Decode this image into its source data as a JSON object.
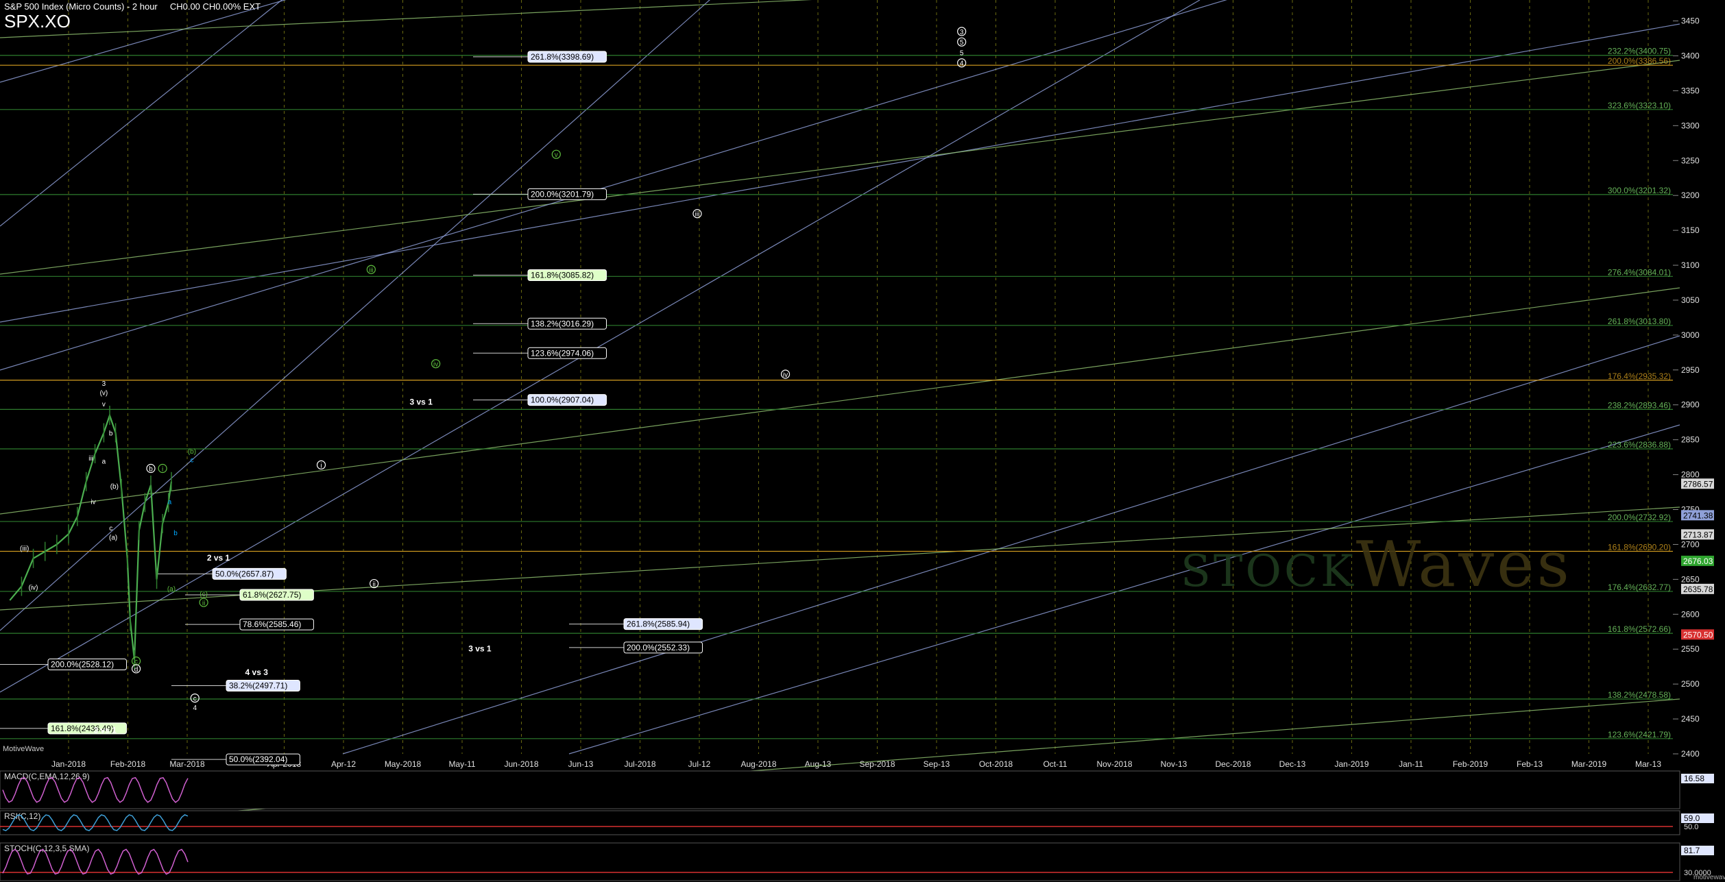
{
  "header": {
    "title": "S&P 500 Index (Micro Counts) - 2 hour",
    "quote": "CH0.00  CH0.00%  EXT",
    "symbol": "SPX.XO"
  },
  "brand": "MotiveWave",
  "watermark": {
    "prefix": "STOCK",
    "suffix": "Waves"
  },
  "footer_brand": "motivewave",
  "colors": {
    "background": "#000000",
    "price_bars": "#2e7d2e",
    "fib_label": "#ffffff",
    "fib_green": "#3aa53a",
    "fib_orange": "#d8a020",
    "channel_blue": "#8f9fd8",
    "channel_green": "#8fbf6f",
    "grid": "#5f5f10"
  },
  "chart_data": {
    "type": "line",
    "title": "S&P 500 Index (Micro Counts) - 2 hour",
    "ylim": [
      2400,
      3480
    ],
    "y_ticks": [
      2400,
      2450,
      2500,
      2550,
      2600,
      2650,
      2700,
      2750,
      2800,
      2850,
      2900,
      2950,
      3000,
      3050,
      3100,
      3150,
      3200,
      3250,
      3300,
      3350,
      3400,
      3450
    ],
    "x_ticks": [
      "Jan-2018",
      "Feb-2018",
      "Mar-2018",
      "Apr-2018",
      "Apr-12",
      "May-2018",
      "May-11",
      "Jun-2018",
      "Jun-13",
      "Jul-2018",
      "Jul-12",
      "Aug-2018",
      "Aug-13",
      "Sep-2018",
      "Sep-13",
      "Oct-2018",
      "Oct-11",
      "Nov-2018",
      "Nov-13",
      "Dec-2018",
      "Dec-13",
      "Jan-2019",
      "Jan-11",
      "Feb-2019",
      "Feb-13",
      "Mar-2019",
      "Mar-13"
    ],
    "series": [
      {
        "values": [
          [
            -1.0,
            2620
          ],
          [
            -0.8,
            2640
          ],
          [
            -0.6,
            2680
          ],
          [
            -0.4,
            2690
          ],
          [
            -0.2,
            2700
          ],
          [
            0.0,
            2715
          ],
          [
            0.15,
            2740
          ],
          [
            0.3,
            2790
          ],
          [
            0.45,
            2830
          ],
          [
            0.6,
            2860
          ],
          [
            0.7,
            2885
          ],
          [
            0.8,
            2860
          ],
          [
            0.9,
            2780
          ],
          [
            1.0,
            2680
          ],
          [
            1.05,
            2590
          ],
          [
            1.12,
            2535
          ],
          [
            1.2,
            2720
          ],
          [
            1.3,
            2760
          ],
          [
            1.4,
            2785
          ],
          [
            1.5,
            2650
          ],
          [
            1.6,
            2730
          ],
          [
            1.7,
            2760
          ],
          [
            1.75,
            2790
          ]
        ]
      }
    ],
    "fib_levels": [
      {
        "label": "261.8%(3398.69)",
        "value": 3398.69,
        "color": "blue"
      },
      {
        "label": "200.0%(3201.79)",
        "value": 3201.79,
        "color": "white"
      },
      {
        "label": "161.8%(3085.82)",
        "value": 3085.82,
        "color": "green"
      },
      {
        "label": "138.2%(3016.29)",
        "value": 3016.29,
        "color": "white"
      },
      {
        "label": "123.6%(2974.06)",
        "value": 2974.06,
        "color": "white"
      },
      {
        "label": "100.0%(2907.04)",
        "value": 2907.04,
        "color": "blue"
      },
      {
        "label": "50.0%(2657.87)",
        "value": 2657.87,
        "color": "blue"
      },
      {
        "label": "61.8%(2627.75)",
        "value": 2627.75,
        "color": "green"
      },
      {
        "label": "78.6%(2585.46)",
        "value": 2585.46,
        "color": "white"
      },
      {
        "label": "261.8%(2585.94)",
        "value": 2585.94,
        "color": "blue"
      },
      {
        "label": "200.0%(2552.33)",
        "value": 2552.33,
        "color": "white"
      },
      {
        "label": "200.0%(2528.12)",
        "value": 2528.12,
        "color": "white"
      },
      {
        "label": "38.2%(2497.71)",
        "value": 2497.71,
        "color": "blue"
      },
      {
        "label": "161.8%(2436.49)",
        "value": 2436.49,
        "color": "green"
      },
      {
        "label": "50.0%(2392.04)",
        "value": 2392.04,
        "color": "white"
      }
    ],
    "right_levels": [
      {
        "label": "232.2%(3400.75)",
        "value": 3400.75,
        "color": "green"
      },
      {
        "label": "200.0%(3386.56)",
        "value": 3386.56,
        "color": "orange"
      },
      {
        "label": "323.6%(3323.10)",
        "value": 3323.1,
        "color": "green"
      },
      {
        "label": "300.0%(3201.32)",
        "value": 3201.32,
        "color": "green"
      },
      {
        "label": "276.4%(3084.01)",
        "value": 3084.01,
        "color": "green"
      },
      {
        "label": "261.8%(3013.80)",
        "value": 3013.8,
        "color": "green"
      },
      {
        "label": "176.4%(2935.32)",
        "value": 2935.32,
        "color": "orange"
      },
      {
        "label": "238.2%(2893.46)",
        "value": 2893.46,
        "color": "green"
      },
      {
        "label": "223.6%(2836.88)",
        "value": 2836.88,
        "color": "green"
      },
      {
        "label": "200.0%(2732.92)",
        "value": 2732.92,
        "color": "green"
      },
      {
        "label": "161.8%(2690.20)",
        "value": 2690.2,
        "color": "orange"
      },
      {
        "label": "176.4%(2632.77)",
        "value": 2632.77,
        "color": "green"
      },
      {
        "label": "161.8%(2572.66)",
        "value": 2572.66,
        "color": "green"
      },
      {
        "label": "138.2%(2478.58)",
        "value": 2478.58,
        "color": "green"
      },
      {
        "label": "123.6%(2421.79)",
        "value": 2421.79,
        "color": "green"
      }
    ],
    "price_tags": [
      {
        "label": "2786.57",
        "value": 2786.57,
        "color": "#d8d8d8",
        "text": "#000"
      },
      {
        "label": "2741.38",
        "value": 2741.38,
        "color": "#8fa0d8",
        "text": "#000"
      },
      {
        "label": "2713.87",
        "value": 2713.87,
        "color": "#d8d8d8",
        "text": "#000"
      },
      {
        "label": "2676.03",
        "value": 2676.03,
        "color": "#2fa52f",
        "text": "#fff"
      },
      {
        "label": "2635.78",
        "value": 2635.78,
        "color": "#d8d8d8",
        "text": "#000"
      },
      {
        "label": "2570.50",
        "value": 2570.5,
        "color": "#d83030",
        "text": "#fff"
      }
    ],
    "annotations": [
      {
        "text": "3 vs 1",
        "x": 6.0,
        "y": 2900
      },
      {
        "text": "2 vs 1",
        "x": 2.55,
        "y": 2677
      },
      {
        "text": "3 vs 1",
        "x": 7.0,
        "y": 2547
      },
      {
        "text": "4 vs 3",
        "x": 3.2,
        "y": 2513
      },
      {
        "text": "3 vs 1",
        "x": 0.62,
        "y": 2430
      }
    ],
    "wave_labels": [
      {
        "text": "i",
        "x": 4.3,
        "y": 2810,
        "color": "#fff",
        "circle": true
      },
      {
        "text": "ii",
        "x": 5.2,
        "y": 2640,
        "color": "#fff",
        "circle": true
      },
      {
        "text": "iii",
        "x": 10.7,
        "y": 3170,
        "color": "#fff",
        "circle": true
      },
      {
        "text": "iv",
        "x": 12.2,
        "y": 2940,
        "color": "#fff",
        "circle": true
      },
      {
        "text": "v",
        "x": 8.3,
        "y": 3255,
        "color": "#5fbf3f",
        "circle": true
      },
      {
        "text": "iii",
        "x": 5.15,
        "y": 3090,
        "color": "#5fbf3f",
        "circle": true
      },
      {
        "text": "iv",
        "x": 6.25,
        "y": 2955,
        "color": "#5fbf3f",
        "circle": true
      },
      {
        "text": "c",
        "x": 2.15,
        "y": 2476,
        "color": "#fff",
        "circle": true
      },
      {
        "text": "4",
        "x": 2.15,
        "y": 2463,
        "color": "#fff",
        "circle": false
      },
      {
        "text": "3",
        "x": 15.2,
        "y": 3431,
        "color": "#fff",
        "circle": true
      },
      {
        "text": "5",
        "x": 15.2,
        "y": 3416,
        "color": "#fff",
        "circle": true
      },
      {
        "text": "5",
        "x": 15.2,
        "y": 3401,
        "color": "#fff",
        "circle": false
      },
      {
        "text": "4",
        "x": 15.2,
        "y": 3386,
        "color": "#fff",
        "circle": true
      },
      {
        "text": "3",
        "x": 0.6,
        "y": 2927,
        "color": "#fff",
        "circle": false
      },
      {
        "text": "(v)",
        "x": 0.6,
        "y": 2914,
        "color": "#fff",
        "circle": false
      },
      {
        "text": "v",
        "x": 0.6,
        "y": 2898,
        "color": "#fff",
        "circle": false
      },
      {
        "text": "b",
        "x": 0.72,
        "y": 2856,
        "color": "#fff",
        "circle": false
      },
      {
        "text": "iii",
        "x": 0.38,
        "y": 2820,
        "color": "#fff",
        "circle": false
      },
      {
        "text": "a",
        "x": 0.6,
        "y": 2816,
        "color": "#fff",
        "circle": false
      },
      {
        "text": "iv",
        "x": 0.42,
        "y": 2758,
        "color": "#fff",
        "circle": false
      },
      {
        "text": "(b)",
        "x": 0.78,
        "y": 2780,
        "color": "#fff",
        "circle": false
      },
      {
        "text": "c",
        "x": 0.72,
        "y": 2720,
        "color": "#fff",
        "circle": false
      },
      {
        "text": "(a)",
        "x": 0.76,
        "y": 2707,
        "color": "#fff",
        "circle": false
      },
      {
        "text": "(iii)",
        "x": -0.75,
        "y": 2691,
        "color": "#fff",
        "circle": false
      },
      {
        "text": "(iv)",
        "x": -0.6,
        "y": 2635,
        "color": "#fff",
        "circle": false
      },
      {
        "text": "b",
        "x": 1.4,
        "y": 2805,
        "color": "#fff",
        "circle": true
      },
      {
        "text": "i",
        "x": 1.6,
        "y": 2805,
        "color": "#5fbf3f",
        "circle": true
      },
      {
        "text": "(b)",
        "x": 2.1,
        "y": 2830,
        "color": "#5fbf3f",
        "circle": false
      },
      {
        "text": "c",
        "x": 2.1,
        "y": 2818,
        "color": "#00aaff",
        "circle": false
      },
      {
        "text": "a",
        "x": 1.72,
        "y": 2758,
        "color": "#00aaff",
        "circle": false
      },
      {
        "text": "b",
        "x": 1.82,
        "y": 2713,
        "color": "#00aaff",
        "circle": false
      },
      {
        "text": "(a)",
        "x": 1.75,
        "y": 2633,
        "color": "#5fbf3f",
        "circle": false
      },
      {
        "text": "(c)",
        "x": 2.3,
        "y": 2626,
        "color": "#5fbf3f",
        "circle": false
      },
      {
        "text": "ii",
        "x": 2.3,
        "y": 2613,
        "color": "#5fbf3f",
        "circle": true
      },
      {
        "text": "c",
        "x": 1.15,
        "y": 2529,
        "color": "#5fbf3f",
        "circle": true
      },
      {
        "text": "d",
        "x": 1.15,
        "y": 2518,
        "color": "#fff",
        "circle": true
      }
    ],
    "indicators": [
      {
        "name": "MACD(C,EMA,12,26,9)",
        "value": "16.58"
      },
      {
        "name": "RSI(C,12)",
        "value": "59.0",
        "level": "50.0"
      },
      {
        "name": "STOCH(C,12,3,5,SMA)",
        "value": "81.7",
        "level": "30.0000"
      }
    ]
  }
}
